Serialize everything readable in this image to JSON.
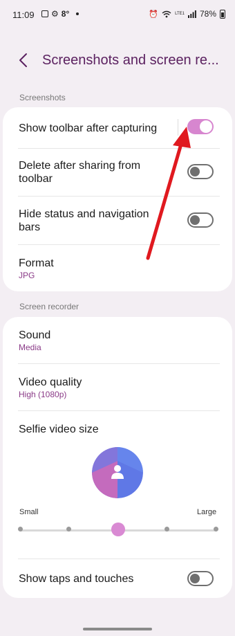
{
  "status_bar": {
    "time": "11:09",
    "temperature": "8°",
    "battery": "78%",
    "network": "LTE1"
  },
  "header": {
    "title": "Screenshots and screen re..."
  },
  "screenshots_section": {
    "label": "Screenshots",
    "items": [
      {
        "title": "Show toolbar after capturing",
        "toggle": "on"
      },
      {
        "title": "Delete after sharing from toolbar",
        "toggle": "off"
      },
      {
        "title": "Hide status and navigation bars",
        "toggle": "off"
      },
      {
        "title": "Format",
        "subtitle": "JPG"
      }
    ]
  },
  "recorder_section": {
    "label": "Screen recorder",
    "sound": {
      "title": "Sound",
      "subtitle": "Media"
    },
    "video_quality": {
      "title": "Video quality",
      "subtitle": "High (1080p)"
    },
    "selfie": {
      "title": "Selfie video size",
      "min_label": "Small",
      "max_label": "Large",
      "level_index": 2,
      "level_count": 5
    },
    "taps": {
      "title": "Show taps and touches",
      "toggle": "off"
    }
  },
  "colors": {
    "accent": "#d786cf",
    "title": "#5b2160",
    "subtitle": "#8a3a87",
    "annotation_arrow": "#e0191f"
  },
  "icons": [
    "picture-icon",
    "gear-icon",
    "alarm-icon",
    "wifi-icon",
    "signal-icon",
    "battery-icon",
    "back-arrow-icon",
    "person-icon"
  ]
}
